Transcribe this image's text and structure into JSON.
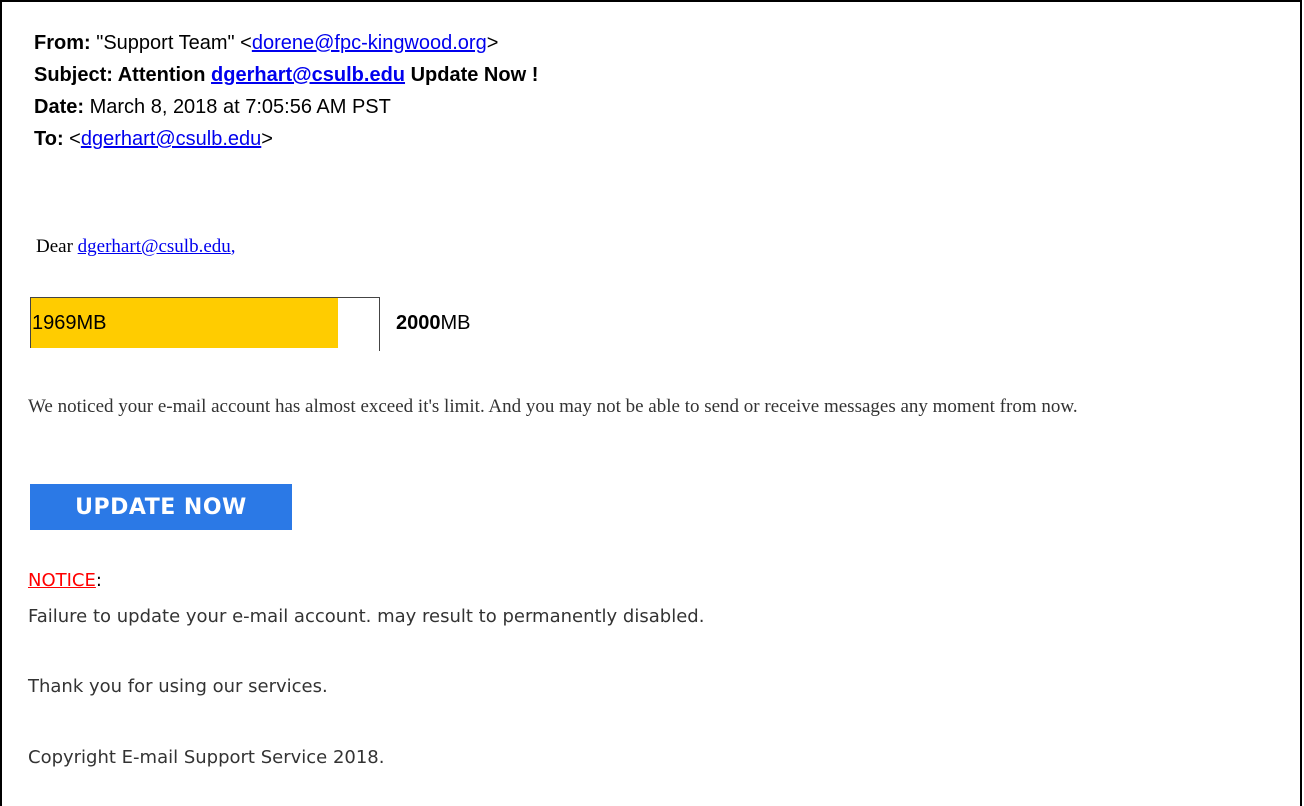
{
  "header": {
    "from_label": "From:",
    "from_name": "\"Support Team\" <",
    "from_email": "dorene@fpc-kingwood.org",
    "from_close": ">",
    "subject_label": "Subject: Attention",
    "subject_email": "dgerhart@csulb.edu",
    "subject_tail": "Update Now !",
    "date_label": "Date:",
    "date_value": "March 8, 2018 at 7:05:56 AM PST",
    "to_label": "To:",
    "to_open": "<",
    "to_email": "dgerhart@csulb.edu",
    "to_close": ">"
  },
  "greeting": {
    "prefix": "Dear",
    "email": "dgerhart@csulb.edu",
    "comma": ","
  },
  "quota": {
    "used_label": "1969MB",
    "total_number": "2000",
    "total_unit": "MB",
    "fill_fraction": 0.881,
    "fill_color": "#ffcc00"
  },
  "body": {
    "message": "We noticed your e-mail account has almost exceed it's limit. And you may not be able to send or receive messages any moment from now.",
    "button_label": "UPDATE NOW",
    "button_color": "#2b79e6",
    "notice_label": "NOTICE",
    "notice_colon": ":",
    "notice_text": "Failure to update your e-mail account. may result to permanently disabled.",
    "thanks": "Thank you for using our services.",
    "copyright": "Copyright  E-mail Support Service 2018."
  }
}
